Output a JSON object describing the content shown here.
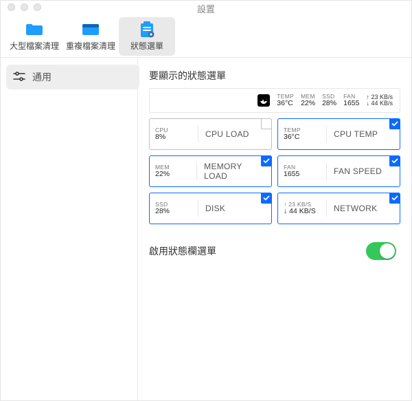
{
  "window": {
    "title": "設置"
  },
  "toolbar": {
    "items": [
      {
        "label": "大型檔案清理",
        "icon": "folder-icon",
        "active": false
      },
      {
        "label": "重複檔案清理",
        "icon": "folder-dark-icon",
        "active": false
      },
      {
        "label": "狀態選單",
        "icon": "clipboard-gear-icon",
        "active": true
      }
    ]
  },
  "sidebar": {
    "items": [
      {
        "label": "通用",
        "icon": "sliders-icon"
      }
    ]
  },
  "section_title": "要顯示的狀態選單",
  "preview": {
    "temp": {
      "t": "TEMP",
      "v": "36°C"
    },
    "mem": {
      "t": "MEM",
      "v": "22%"
    },
    "ssd": {
      "t": "SSD",
      "v": "28%"
    },
    "fan": {
      "t": "FAN",
      "v": "1655"
    },
    "net_up": "↑ 23 KB/s",
    "net_down": "↓ 44 KB/s"
  },
  "cards": [
    {
      "small_t": "CPU",
      "small_v": "8%",
      "label": "CPU LOAD",
      "selected": false
    },
    {
      "small_t": "TEMP",
      "small_v": "36°C",
      "label": "CPU TEMP",
      "selected": true
    },
    {
      "small_t": "MEM",
      "small_v": "22%",
      "label": "MEMORY LOAD",
      "selected": true
    },
    {
      "small_t": "FAN",
      "small_v": "1655",
      "label": "FAN SPEED",
      "selected": true
    },
    {
      "small_t": "SSD",
      "small_v": "28%",
      "label": "DISK",
      "selected": true
    },
    {
      "small_t": "↑ 23 KB/S",
      "small_v": "↓ 44 KB/S",
      "label": "NETWORK",
      "selected": true
    }
  ],
  "toggle": {
    "label": "啟用狀態欄選單",
    "on": true
  }
}
